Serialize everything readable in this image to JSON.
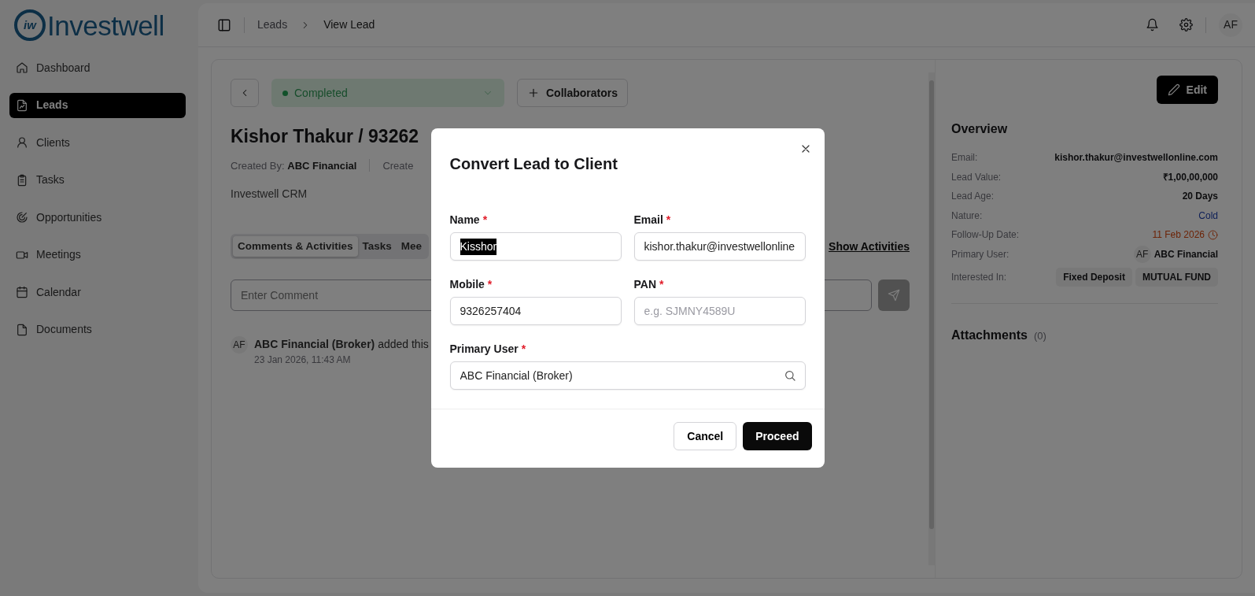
{
  "logo": {
    "mark": "iw",
    "text": "Investwell"
  },
  "sidebar": {
    "items": [
      {
        "label": "Dashboard",
        "selected": false
      },
      {
        "label": "Leads",
        "selected": true
      },
      {
        "label": "Clients",
        "selected": false
      },
      {
        "label": "Tasks",
        "selected": false
      },
      {
        "label": "Opportunities",
        "selected": false
      },
      {
        "label": "Meetings",
        "selected": false
      },
      {
        "label": "Calendar",
        "selected": false
      },
      {
        "label": "Documents",
        "selected": false
      }
    ]
  },
  "header": {
    "breadcrumb": [
      "Leads",
      "View Lead"
    ],
    "avatar": "AF"
  },
  "lead": {
    "status": "Completed",
    "collaborators_button": "Collaborators",
    "title": "Kishor Thakur / 93262",
    "created_by_label": "Created By:",
    "created_by": "ABC Financial",
    "created_cut": "Create",
    "company": "Investwell CRM",
    "tabs": [
      {
        "label": "Comments & Activities",
        "selected": true
      },
      {
        "label": "Tasks",
        "selected": false
      },
      {
        "label": "Mee",
        "selected": false
      }
    ],
    "show_activities": "Show Activities",
    "comment_placeholder": "Enter Comment",
    "activities": [
      {
        "avatar": "AF",
        "text": "**ABC Financial (Broker)** added this",
        "time": "23 Jan 2026, 11:43 AM"
      }
    ]
  },
  "overview": {
    "edit_button": "Edit",
    "title": "Overview",
    "rows": [
      {
        "label": "Email:",
        "kind": "text",
        "value": "kishor.thakur@investwellonline.com"
      },
      {
        "label": "Lead Value:",
        "kind": "text",
        "value": "₹1,00,00,000"
      },
      {
        "label": "Lead Age:",
        "kind": "text",
        "value": "20 Days"
      },
      {
        "label": "Nature:",
        "kind": "nature",
        "value": "Cold"
      },
      {
        "label": "Follow-Up Date:",
        "kind": "date",
        "value": "11 Feb 2026"
      },
      {
        "label": "Primary User:",
        "kind": "user",
        "avatar": "AF",
        "value": "ABC Financial"
      },
      {
        "label": "Interested In:",
        "kind": "tags",
        "tags": [
          "Fixed Deposit",
          "MUTUAL FUND"
        ]
      }
    ],
    "attachments": {
      "title": "Attachments",
      "count": "(0)"
    }
  },
  "modal": {
    "title": "Convert Lead to Client",
    "fields": [
      {
        "label": "Name",
        "required_mark": "*",
        "kind": "text",
        "value": "Kisshor",
        "text_selected": true
      },
      {
        "label": "Email",
        "required_mark": "*",
        "kind": "text",
        "value": "kishor.thakur@investwellonline"
      },
      {
        "label": "Mobile",
        "required_mark": "*",
        "kind": "text",
        "value": "9326257404"
      },
      {
        "label": "PAN",
        "required_mark": "*",
        "kind": "text",
        "placeholder": "e.g. SJMNY4589U"
      },
      {
        "label": "Primary User",
        "required_mark": "*",
        "kind": "search",
        "value": "ABC Financial (Broker)"
      }
    ],
    "cancel_button": "Cancel",
    "proceed_button": "Proceed"
  }
}
